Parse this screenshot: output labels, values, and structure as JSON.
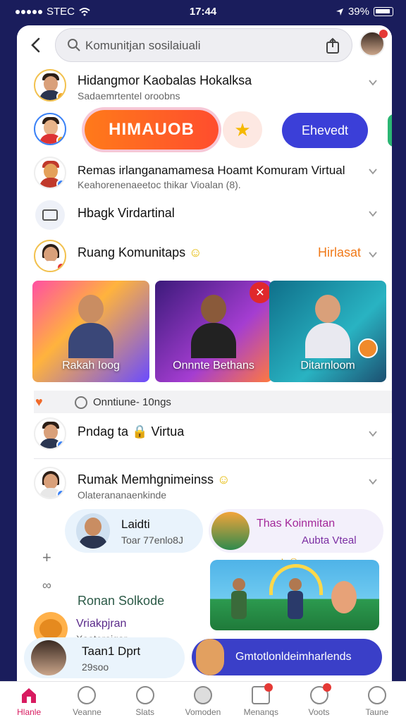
{
  "status_bar": {
    "carrier": "STEC",
    "time": "17:44",
    "battery": "39%"
  },
  "search": {
    "value": "Komunitjan sosilaiuali"
  },
  "rows": [
    {
      "title": "Hidangmor Kaobalas Hokalksa",
      "subtitle": "Sadaemrtentel oroobns"
    },
    {
      "title": "Remas irlanganamamesa Hoamt Komuram Virtual",
      "subtitle": "Keahorenenaeetoc thikar Vioalan (8)."
    },
    {
      "title": "Hbagk Virdartinal"
    },
    {
      "title": "Ruang Komunitaps",
      "link": "Hirlasat"
    }
  ],
  "pills": {
    "orange": "HIMAUOB",
    "blue": "Ehevedt"
  },
  "cards": [
    {
      "label": "Rakah Ioog"
    },
    {
      "label": "Onnnte Bethans"
    },
    {
      "label": "Ditarnloom"
    }
  ],
  "online": {
    "text": "Onntiune- 10ngs"
  },
  "rows2": [
    {
      "title": "Pndag ta",
      "title_after": "Virtua"
    },
    {
      "title": "Rumak Memhgnimeinss",
      "subtitle": "Olaterananaenkinde"
    }
  ],
  "chips": {
    "chip1": {
      "title": "Laidti",
      "subtitle": "Toar 77enlo8J"
    },
    "chip2": {
      "title": "Thas Koinmitan",
      "subtitle": "Aubta Vteal"
    },
    "chip3": {
      "title": "Taan1 Dprt",
      "subtitle": "29soo"
    }
  },
  "section": {
    "title": "Ronan Solkode",
    "sub_title": "Vriakpjran",
    "sub_text": "Xaateraigar"
  },
  "cta": {
    "label": "Gmtotlonldeimharlends"
  },
  "nav": [
    {
      "label": "Hlanle"
    },
    {
      "label": "Veanne"
    },
    {
      "label": "Slats"
    },
    {
      "label": "Vomoden"
    },
    {
      "label": "Menanqs"
    },
    {
      "label": "Voots"
    },
    {
      "label": "Taune"
    }
  ],
  "colors": {
    "accent": "#3b3fd8",
    "orange": "#ff6a1f",
    "nav_active": "#d81b60",
    "background": "#1a1d5c"
  }
}
